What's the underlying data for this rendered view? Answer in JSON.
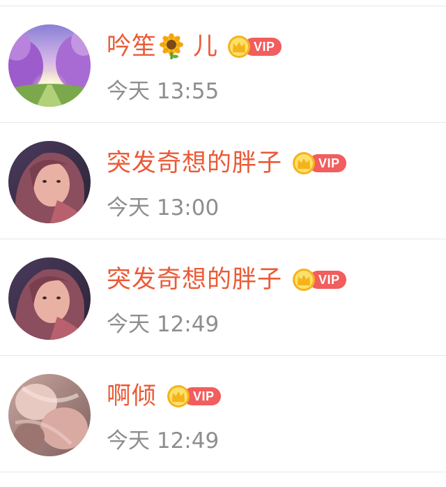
{
  "items": [
    {
      "name": "吟笙",
      "name_suffix": "儿",
      "name_emoji": "sunflower-icon",
      "badge": "VIP",
      "time": "今天 13:55",
      "avatar": "lavender-field-avatar"
    },
    {
      "name": "突发奇想的胖子",
      "badge": "VIP",
      "time": "今天 13:00",
      "avatar": "portrait-avatar"
    },
    {
      "name": "突发奇想的胖子",
      "badge": "VIP",
      "time": "今天 12:49",
      "avatar": "portrait-avatar"
    },
    {
      "name": "啊倾",
      "badge": "VIP",
      "time": "今天 12:49",
      "avatar": "pink-photo-avatar"
    }
  ],
  "colors": {
    "name": "#eb5a36",
    "time": "#8e8e8e",
    "vip_pill": "#f25d5d",
    "crown": "#f5b31b",
    "separator": "#e7e7e7"
  }
}
